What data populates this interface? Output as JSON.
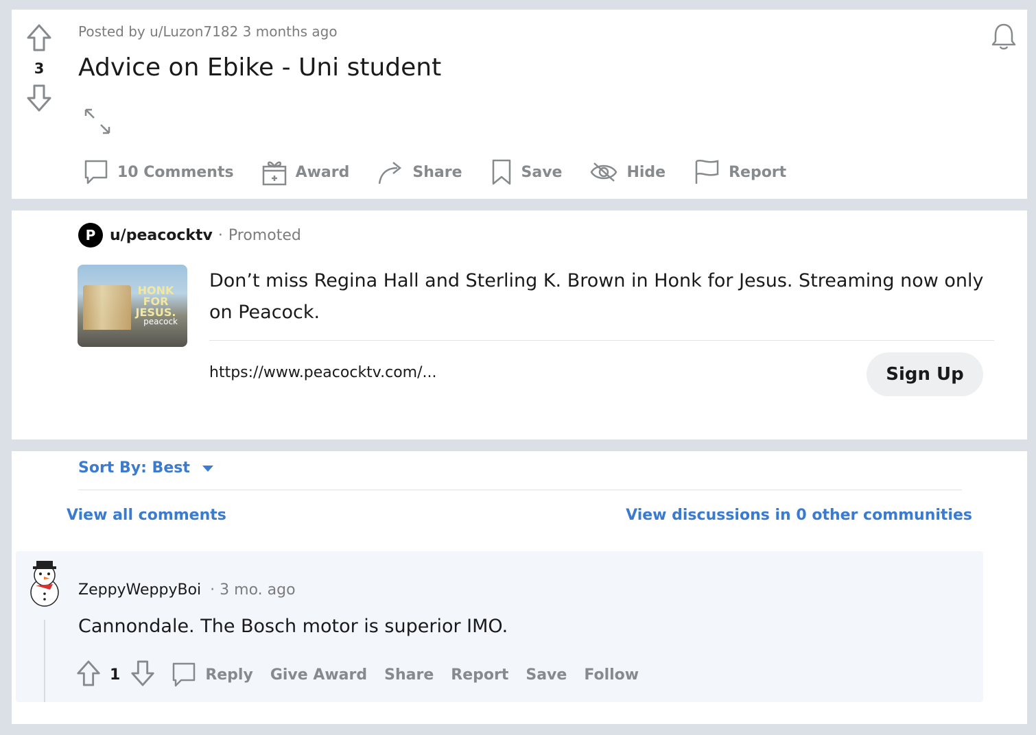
{
  "post": {
    "vote_count": "3",
    "meta": "Posted by u/Luzon7182 3 months ago",
    "title": "Advice on Ebike - Uni student",
    "actions": {
      "comments": "10 Comments",
      "award": "Award",
      "share": "Share",
      "save": "Save",
      "hide": "Hide",
      "report": "Report"
    },
    "icons": [
      "arrow-up-icon",
      "arrow-down-icon",
      "expand-icon",
      "bell-icon",
      "comment-icon",
      "gift-icon",
      "share-arrow-icon",
      "bookmark-icon",
      "eye-slash-icon",
      "flag-icon"
    ]
  },
  "ad": {
    "username": "u/peacocktv",
    "separator": "·",
    "promoted_label": "Promoted",
    "avatar_letter": "P",
    "thumbnail": {
      "title": "HONK FOR JESUS.",
      "brand": "peacock"
    },
    "text": "Don’t miss Regina Hall and Sterling K. Brown in Honk for Jesus. Streaming now only on Peacock.",
    "url": "https://www.peacocktv.com/...",
    "cta_label": "Sign Up"
  },
  "comments": {
    "sort_label": "Sort By: Best",
    "view_all_label": "View all comments",
    "view_discussions_label": "View discussions in 0 other communities",
    "items": [
      {
        "author": "ZeppyWeppyBoi",
        "time": "· 3 mo. ago",
        "body": "Cannondale. The Bosch motor is superior IMO.",
        "score": "1",
        "actions": {
          "reply": "Reply",
          "give_award": "Give Award",
          "share": "Share",
          "report": "Report",
          "save": "Save",
          "follow": "Follow"
        }
      }
    ]
  },
  "colors": {
    "background": "#dae0e6",
    "link_blue": "#3a7bd0",
    "action_gray": "#878a8c",
    "text_dark": "#1a1a1b",
    "comment_bg": "#f3f6fb"
  }
}
